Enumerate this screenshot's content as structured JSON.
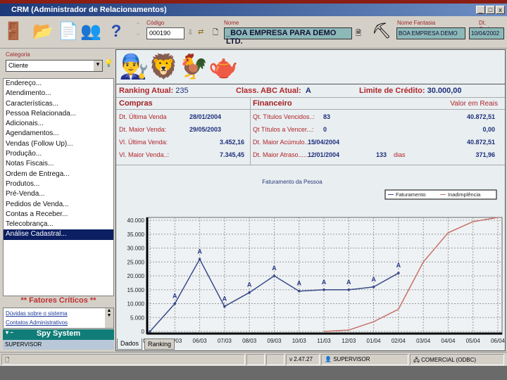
{
  "window": {
    "title": "CRM (Administrador de Relacionamentos)",
    "minimize": "_",
    "maximize": "□",
    "close": "x"
  },
  "toolbar": {
    "codigo_label": "Código",
    "codigo_value": "000190",
    "nome_label": "Nome",
    "nome_value": "_BOA EMPRESA PARA DEMO LTD.",
    "fantasia_label": "Nome Fantasia",
    "fantasia_value": "BOA EMPRESA DEMO",
    "cadastro_label": "Dt. Cadastro",
    "cadastro_value": "10/04/2002"
  },
  "left": {
    "categoria_label": "Categoria",
    "categoria_value": "Cliente",
    "items": [
      "Endereço...",
      "Atendimento...",
      "Características...",
      "Pessoa Relacionada...",
      "Adicionais...",
      "Agendamentos...",
      "Vendas (Follow Up)...",
      "Produção...",
      "Notas Fiscais...",
      "Ordem de Entrega...",
      "Produtos...",
      "Pré-Venda...",
      "Pedidos de Venda...",
      "Contas a Receber...",
      "Telecobrança...",
      "Análise Cadastral..."
    ],
    "fatores_title": "** Fatores Críticos **",
    "fatores_links": [
      "Dúvidas sobre o sistema",
      "Contatos Administrativos"
    ],
    "spy_title": "Spy System",
    "spy_user": "SUPERVISOR"
  },
  "summary": {
    "ranking_label": "Ranking Atual:",
    "ranking_value": "235",
    "abc_label": "Class. ABC Atual:",
    "abc_value": "A",
    "limite_label": "Limite de Crédito:",
    "limite_value": "30.000,00"
  },
  "compras": {
    "title": "Compras",
    "rows": [
      {
        "label": "Dt. Última Venda",
        "value": "28/01/2004"
      },
      {
        "label": "Dt. Maior Venda:",
        "value": "29/05/2003"
      },
      {
        "label": "Vl. Última Venda:",
        "value": "3.452,16"
      },
      {
        "label": "Vl. Maior Venda..:",
        "value": "7.345,45"
      }
    ]
  },
  "financeiro": {
    "title": "Financeiro",
    "valor_label": "Valor em Reais",
    "rows": [
      {
        "label": "Qt. Títulos Vencidos..:",
        "value": "83",
        "extra": "",
        "amount": "40.872,51"
      },
      {
        "label": "Qt Títulos a Vencer...:",
        "value": "0",
        "extra": "",
        "amount": "0,00"
      },
      {
        "label": "Dt. Maior Acúmulo.....:",
        "value": "15/04/2004",
        "extra": "",
        "amount": "40.872,51"
      },
      {
        "label": "Dt. Maior Atraso.........:",
        "value": "12/01/2004",
        "extra": "133",
        "extra_unit": "dias",
        "amount": "371,96"
      }
    ]
  },
  "tabs": [
    "Dados",
    "Ranking"
  ],
  "status": {
    "version": "v 2.47.27",
    "user": "SUPERVISOR",
    "db": "COMERCIAL (ODBC)"
  },
  "chart_data": {
    "type": "line",
    "title": "Faturamento da Pessoa",
    "categories": [
      "04/03",
      "05/03",
      "06/03",
      "07/03",
      "08/03",
      "09/03",
      "10/03",
      "11/03",
      "12/03",
      "01/04",
      "02/04",
      "03/04",
      "04/04",
      "05/04",
      "06/04"
    ],
    "ylim": [
      0,
      40000
    ],
    "yticks": [
      "0",
      "5.000",
      "10.000",
      "15.000",
      "20.000",
      "25.000",
      "30.000",
      "35.000",
      "40.000"
    ],
    "grid": true,
    "legend": "top-right",
    "series": [
      {
        "name": "Faturamento",
        "color": "#3a4a8a",
        "values": [
          0,
          10000,
          26000,
          9000,
          14000,
          20000,
          14500,
          15000,
          15000,
          16000,
          21000,
          null,
          null,
          null,
          null
        ],
        "labels": [
          "",
          "A",
          "A",
          "A",
          "A",
          "A",
          "A",
          "A",
          "A",
          "A",
          "A",
          "",
          "",
          "",
          ""
        ]
      },
      {
        "name": "Inadimplência",
        "color": "#c8706a",
        "values": [
          null,
          null,
          null,
          null,
          null,
          null,
          null,
          0,
          500,
          3500,
          8000,
          25000,
          35500,
          39500,
          41000
        ]
      }
    ]
  }
}
